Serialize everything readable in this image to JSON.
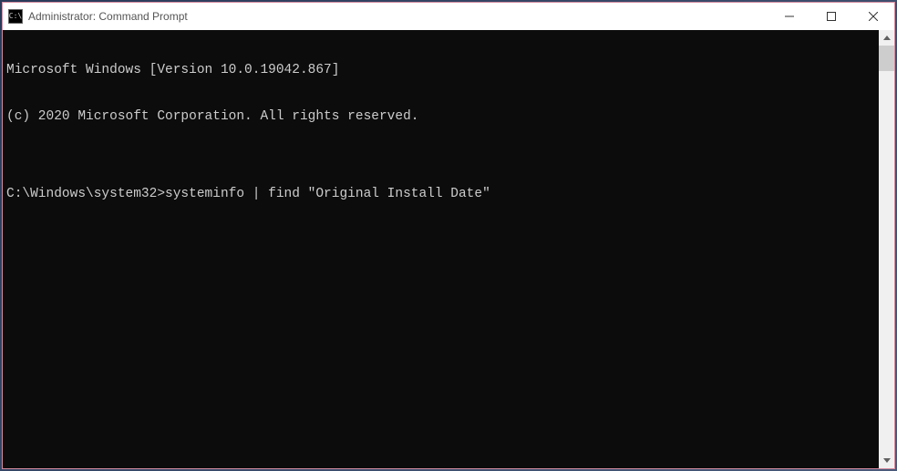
{
  "window": {
    "title": "Administrator: Command Prompt",
    "icon_text": "C:\\"
  },
  "console": {
    "lines": [
      "Microsoft Windows [Version 10.0.19042.867]",
      "(c) 2020 Microsoft Corporation. All rights reserved.",
      "",
      "C:\\Windows\\system32>systeminfo | find \"Original Install Date\""
    ]
  }
}
